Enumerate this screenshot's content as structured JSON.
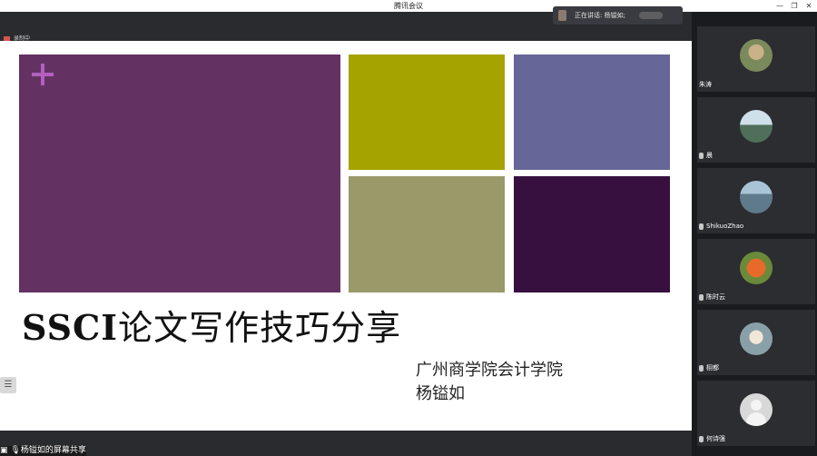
{
  "window": {
    "title": "腾讯会议",
    "minimize_glyph": "—",
    "restore_glyph": "❐",
    "close_glyph": "✕"
  },
  "top_bar": {
    "speaker_label": "正在讲话: 杨镒如;",
    "record_label": "录制中"
  },
  "slide": {
    "title_latin": "SSCI",
    "title_cn": "论文写作技巧分享",
    "subtitle_line1": "广州商学院会计学院",
    "subtitle_line2": "杨镒如",
    "tile_colors": [
      "#633263",
      "#a5a300",
      "#676698",
      "#99996a",
      "#371040"
    ],
    "plus_color": "#b45fbf",
    "list_button_glyph": "☰"
  },
  "bottom_bar": {
    "share_label": "杨镒如的屏幕共享"
  },
  "participants": [
    {
      "name": "朱涛",
      "avatar_icon": "photo-avatar-icon",
      "color": "#7a8a5a"
    },
    {
      "name": "晨",
      "avatar_icon": "photo-avatar-icon",
      "color": "#4f6f5a"
    },
    {
      "name": "ShikuoZhao",
      "avatar_icon": "photo-avatar-icon",
      "color": "#5f7a8a"
    },
    {
      "name": "陈时云",
      "avatar_icon": "photo-avatar-icon",
      "color": "#c24a1e"
    },
    {
      "name": "栩都",
      "avatar_icon": "photo-avatar-icon",
      "color": "#8aa0a8"
    },
    {
      "name": "何诗强",
      "avatar_icon": "default-avatar-icon",
      "color": "#d8d8d8"
    }
  ]
}
